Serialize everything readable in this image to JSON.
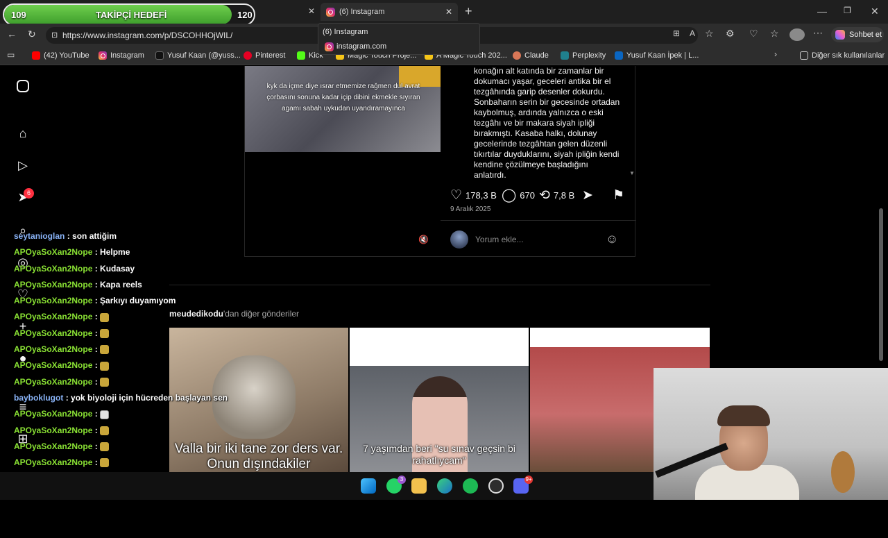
{
  "follow_goal": {
    "current": "109",
    "label": "TAKİPÇİ HEDEFİ",
    "target": "120",
    "progress": 0.91
  },
  "browser": {
    "active_tab_title": "(6) Instagram",
    "tooltip_title": "(6) Instagram",
    "tooltip_domain": "instagram.com",
    "url": "https://www.instagram.com/p/DSCOHHOjWIL/",
    "copilot_label": "Sohbet et",
    "bookmarks": [
      "(42) YouTube",
      "Instagram",
      "Yusuf Kaan (@yuss...",
      "Pinterest",
      "Kick",
      "Magic Touch Proje...",
      "A Magic Touch 202...",
      "Claude",
      "Perplexity",
      "Yusuf Kaan İpek | L..."
    ],
    "other_bookmarks": "Diğer sık kullanılanlar"
  },
  "sidebar": {
    "notification_count": "6"
  },
  "post": {
    "media_caption": "kyk da içme diye ısrar etmemize rağmen dul avrat çorbasını sonuna kadar içip dibini ekmekle sıyıran agamı sabah uykudan uyandıramayınca",
    "caption": "konağın alt katında bir zamanlar bir dokumacı yaşar, geceleri antika bir el tezgâhında garip desenler dokurdu. Sonbaharın serin bir gecesinde ortadan kaybolmuş, ardında yalnızca o eski tezgâhı ve bir makara siyah ipliği bırakmıştı. Kasaba halkı, dolunay gecelerinde tezgâhtan gelen düzenli tıkırtılar duyduklarını, siyah ipliğin kendi kendine çözülmeye başladığını anlatırdı.",
    "likes": "178,3 B",
    "comments": "670",
    "reposts": "7,8 B",
    "date": "9 Aralık 2025",
    "comment_placeholder": "Yorum ekle..."
  },
  "more_posts": {
    "account": "meudedikodu",
    "suffix": "'dan diğer gönderiler",
    "thumbs": [
      {
        "text": "Valla bir iki tane zor ders var. Onun dışındakiler"
      },
      {
        "text": "7 yaşımdan beri \"su sınav geçsin bi rahatlıycam\""
      },
      {
        "text": ""
      }
    ]
  },
  "chat": [
    {
      "user": "seytanioglan",
      "msg": ": son attiğim",
      "color": "blue"
    },
    {
      "user": "APOyaSoXan2Nope",
      "msg": ": Helpme",
      "color": "green"
    },
    {
      "user": "APOyaSoXan2Nope",
      "msg": ": Kudasay",
      "color": "green"
    },
    {
      "user": "APOyaSoXan2Nope",
      "msg": ": Kapa reels",
      "color": "green"
    },
    {
      "user": "APOyaSoXan2Nope",
      "msg": ": Şarkıyı duyamıyom",
      "color": "green"
    },
    {
      "user": "APOyaSoXan2Nope",
      "msg": ":",
      "color": "green",
      "emote": "y"
    },
    {
      "user": "APOyaSoXan2Nope",
      "msg": ":",
      "color": "green",
      "emote": "y"
    },
    {
      "user": "APOyaSoXan2Nope",
      "msg": ":",
      "color": "green",
      "emote": "y"
    },
    {
      "user": "APOyaSoXan2Nope",
      "msg": ":",
      "color": "green",
      "emote": "y"
    },
    {
      "user": "APOyaSoXan2Nope",
      "msg": ":",
      "color": "green",
      "emote": "y"
    },
    {
      "user": "bayboklugot",
      "msg": ": yok biyoloji için hücreden başlayan sen",
      "color": "blue"
    },
    {
      "user": "APOyaSoXan2Nope",
      "msg": ":",
      "color": "green",
      "emote": "w"
    },
    {
      "user": "APOyaSoXan2Nope",
      "msg": ":",
      "color": "green",
      "emote": "y"
    },
    {
      "user": "APOyaSoXan2Nope",
      "msg": ":",
      "color": "green",
      "emote": "y"
    },
    {
      "user": "APOyaSoXan2Nope",
      "msg": ":",
      "color": "green",
      "emote": "y"
    },
    {
      "user": "APOyaSoXan2Nope",
      "msg": ":",
      "color": "green",
      "emote": "y"
    }
  ],
  "taskbar": {
    "whatsapp_badge": "3",
    "discord_badge": "9+"
  },
  "colors": {
    "accent_green": "#8ae234",
    "accent_blue": "#8ab4f8",
    "notification_red": "#ff3040"
  }
}
